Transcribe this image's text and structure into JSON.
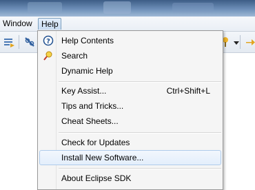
{
  "menubar": {
    "window_label": "Window",
    "help_label": "Help"
  },
  "toolbar": {
    "icons": [
      "task-list-icon",
      "disconnect-icon",
      "pin-icon",
      "dropdown-arrow-icon",
      "forward-icon"
    ]
  },
  "help_menu": {
    "items": [
      {
        "label": "Help Contents",
        "icon": "help-circle-icon"
      },
      {
        "label": "Search",
        "icon": "search-lamp-icon"
      },
      {
        "label": "Dynamic Help"
      },
      {
        "label": "Key Assist...",
        "shortcut": "Ctrl+Shift+L"
      },
      {
        "label": "Tips and Tricks..."
      },
      {
        "label": "Cheat Sheets..."
      },
      {
        "label": "Check for Updates"
      },
      {
        "label": "Install New Software...",
        "highlighted": true
      },
      {
        "label": "About Eclipse SDK"
      }
    ]
  },
  "colors": {
    "highlight_border": "#aecbeb",
    "menu_bg": "#f5f5f5",
    "titlebar": "#3d5d86"
  }
}
